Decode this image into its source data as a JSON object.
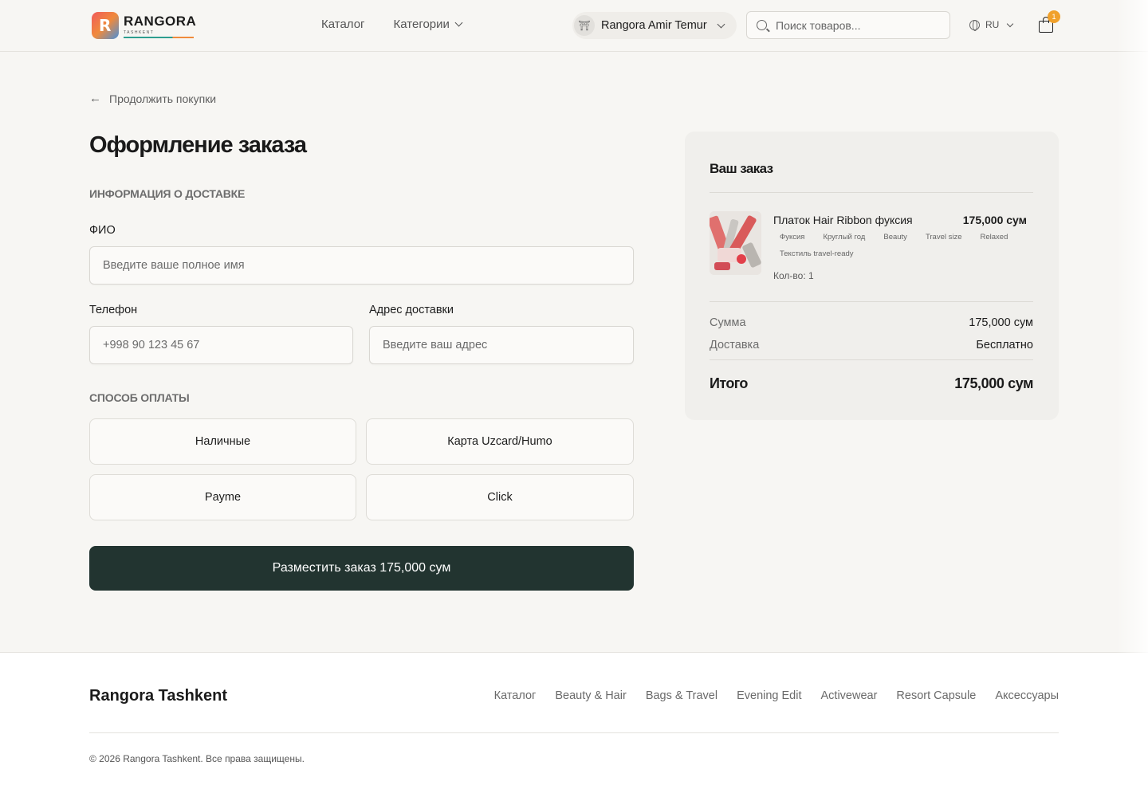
{
  "header": {
    "logo_name": "RANGORA",
    "logo_sub": "TASHKENT",
    "nav": {
      "catalog": "Каталог",
      "categories": "Категории"
    },
    "store": "Rangora Amir Temur",
    "search_placeholder": "Поиск товаров...",
    "lang": "RU",
    "cart_count": "1"
  },
  "back_link": "Продолжить покупки",
  "form": {
    "title": "Оформление заказа",
    "delivery_section": "ИНФОРМАЦИЯ О ДОСТАВКЕ",
    "name_label": "ФИО",
    "name_placeholder": "Введите ваше полное имя",
    "phone_label": "Телефон",
    "phone_placeholder": "+998 90 123 45 67",
    "address_label": "Адрес доставки",
    "address_placeholder": "Введите ваш адрес",
    "payment_section": "СПОСОБ ОПЛАТЫ",
    "payment_methods": [
      "Наличные",
      "Карта Uzcard/Humo",
      "Payme",
      "Click"
    ],
    "submit": "Разместить заказ 175,000 сум"
  },
  "summary": {
    "title": "Ваш заказ",
    "item": {
      "name": "Платок Hair Ribbon фуксия",
      "price": "175,000 сум",
      "tags": [
        "Фуксия",
        "Круглый год",
        "Beauty",
        "Travel size",
        "Relaxed",
        "Текстиль travel-ready"
      ],
      "qty": "Кол-во: 1"
    },
    "subtotal_label": "Сумма",
    "subtotal_value": "175,000 сум",
    "delivery_label": "Доставка",
    "delivery_value": "Бесплатно",
    "total_label": "Итого",
    "total_value": "175,000 сум"
  },
  "footer": {
    "brand": "Rangora Tashkent",
    "links": [
      "Каталог",
      "Beauty & Hair",
      "Bags & Travel",
      "Evening Edit",
      "Activewear",
      "Resort Capsule",
      "Аксессуары"
    ],
    "copyright": "© 2026 Rangora Tashkent. Все права защищены."
  }
}
